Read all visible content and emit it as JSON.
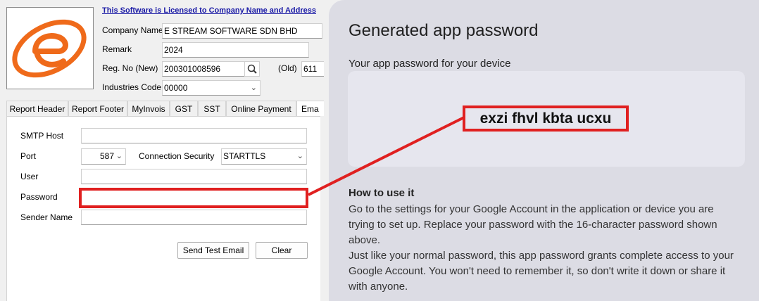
{
  "license_text": "This Software is Licensed to Company Name and Address",
  "company": {
    "name_label": "Company Name",
    "name_value": "E STREAM SOFTWARE SDN BHD",
    "remark_label": "Remark",
    "remark_value": "2024",
    "regno_label": "Reg. No (New)",
    "regno_value": "200301008596",
    "old_label": "(Old)",
    "old_value": "611",
    "industries_label": "Industries Code",
    "industries_value": "00000"
  },
  "tabs": [
    "Report Header",
    "Report Footer",
    "MyInvois",
    "GST",
    "SST",
    "Online Payment",
    "Ema"
  ],
  "email_form": {
    "smtp_host_label": "SMTP Host",
    "smtp_host_value": "",
    "port_label": "Port",
    "port_value": "587",
    "connection_security_label": "Connection Security",
    "connection_security_value": "STARTTLS",
    "user_label": "User",
    "user_value": "",
    "password_label": "Password",
    "password_value": "",
    "sender_name_label": "Sender Name",
    "sender_name_value": "",
    "send_test_label": "Send Test Email",
    "clear_label": "Clear"
  },
  "app_password": {
    "title": "Generated app password",
    "subtitle": "Your app password for your device",
    "password": "exzi fhvl kbta ucxu",
    "howto_title": "How to use it",
    "howto_lines": [
      "Go to the settings for your Google Account in the application or device you are",
      "trying to set up. Replace your password with the 16-character password shown",
      "above.",
      "Just like your normal password, this app password grants complete access to your",
      "Google Account. You won't need to remember it, so don't write it down or share it",
      "with anyone."
    ]
  },
  "colors": {
    "highlight": "#e02020",
    "logo_orange": "#ef6a1a",
    "link_blue": "#1a1aa6"
  }
}
